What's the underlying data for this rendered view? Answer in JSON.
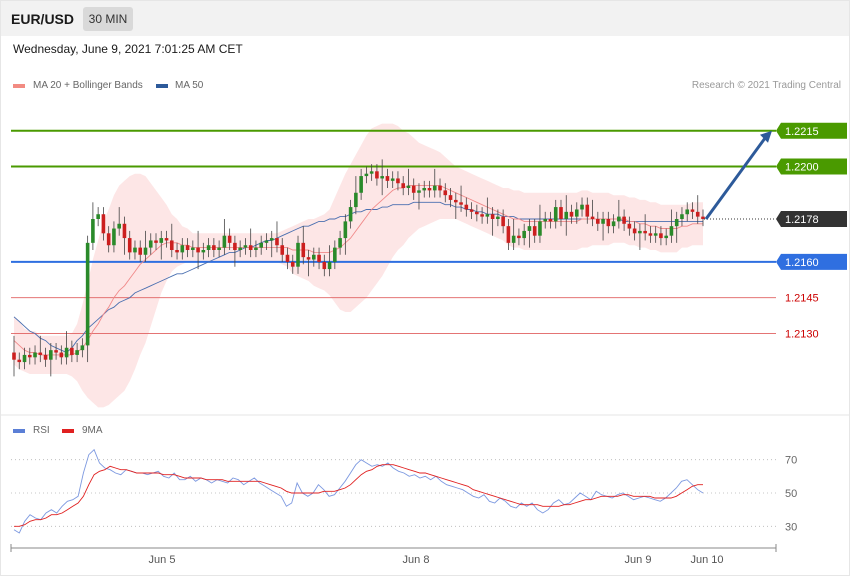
{
  "header": {
    "symbol": "EUR/USD",
    "timeframe": "30 MIN"
  },
  "timestamp": "Wednesday, June 9, 2021 7:01:25 AM CET",
  "legend": {
    "ma20": {
      "label": "MA 20 + Bollinger Bands",
      "color": "#f28b82"
    },
    "ma50": {
      "label": "MA 50",
      "color": "#2d5a9a"
    },
    "rsi": {
      "label": "RSI",
      "color": "#5b7fd6"
    },
    "rsi_ma": {
      "label": "9MA",
      "color": "#e02020"
    }
  },
  "credit": "Research © 2021 Trading Central",
  "chart_data": [
    {
      "type": "candlestick",
      "ylim": [
        1.21,
        1.223
      ],
      "xticks": [
        "Jun 5",
        "Jun 8",
        "Jun 9",
        "Jun 10"
      ],
      "current_price": {
        "label": "1.2178",
        "value": 1.2178
      },
      "levels": [
        {
          "label": "1.2215",
          "value": 1.2215,
          "kind": "resistance",
          "color": "#4a9a00"
        },
        {
          "label": "1.2200",
          "value": 1.22,
          "kind": "resistance",
          "color": "#4a9a00"
        },
        {
          "label": "1.2160",
          "value": 1.216,
          "kind": "pivot",
          "color": "#2f6fe0"
        },
        {
          "label": "1.2145",
          "value": 1.2145,
          "kind": "support",
          "color": "#e06060"
        },
        {
          "label": "1.2130",
          "value": 1.213,
          "kind": "support",
          "color": "#e06060"
        }
      ],
      "projection": {
        "from": 1.2178,
        "to": 1.2215
      },
      "close": [
        1.2119,
        1.2118,
        1.2121,
        1.212,
        1.2122,
        1.2121,
        1.2119,
        1.2123,
        1.2122,
        1.212,
        1.2124,
        1.2121,
        1.2123,
        1.2125,
        1.2168,
        1.2178,
        1.218,
        1.2172,
        1.2167,
        1.2174,
        1.2176,
        1.217,
        1.2164,
        1.2166,
        1.2163,
        1.2166,
        1.2169,
        1.2168,
        1.217,
        1.2169,
        1.2165,
        1.2164,
        1.2167,
        1.2165,
        1.2166,
        1.2164,
        1.2165,
        1.2167,
        1.2165,
        1.2166,
        1.2171,
        1.2168,
        1.2165,
        1.2166,
        1.2167,
        1.2165,
        1.2166,
        1.2168,
        1.2169,
        1.217,
        1.2167,
        1.2163,
        1.216,
        1.2158,
        1.2168,
        1.2162,
        1.2161,
        1.2163,
        1.216,
        1.2157,
        1.216,
        1.2166,
        1.217,
        1.2177,
        1.2183,
        1.2189,
        1.2196,
        1.2197,
        1.2198,
        1.2195,
        1.2196,
        1.2194,
        1.2195,
        1.2193,
        1.2191,
        1.2192,
        1.2189,
        1.219,
        1.2191,
        1.219,
        1.2192,
        1.219,
        1.2188,
        1.2186,
        1.2185,
        1.2184,
        1.2182,
        1.2181,
        1.218,
        1.2179,
        1.218,
        1.2178,
        1.2179,
        1.2175,
        1.2168,
        1.2171,
        1.217,
        1.2173,
        1.2175,
        1.2171,
        1.2177,
        1.2178,
        1.2177,
        1.2183,
        1.2178,
        1.2181,
        1.2179,
        1.2182,
        1.2184,
        1.2179,
        1.2178,
        1.2176,
        1.2178,
        1.2175,
        1.2177,
        1.2179,
        1.2176,
        1.2174,
        1.2172,
        1.2173,
        1.2172,
        1.2171,
        1.2172,
        1.217,
        1.2171,
        1.2175,
        1.2178,
        1.218,
        1.2182,
        1.2181,
        1.2179,
        1.2178
      ],
      "ma50": [
        1.2137,
        1.2135,
        1.2133,
        1.2131,
        1.213,
        1.2128,
        1.2127,
        1.2125,
        1.2124,
        1.2123,
        1.2122,
        1.2124,
        1.2127,
        1.2129,
        1.2132,
        1.2134,
        1.2136,
        1.2138,
        1.214,
        1.2141,
        1.2143,
        1.2144,
        1.2145,
        1.2147,
        1.2148,
        1.2149,
        1.215,
        1.2151,
        1.2152,
        1.2153,
        1.2154,
        1.2155,
        1.2155,
        1.2156,
        1.2157,
        1.2158,
        1.2159,
        1.216,
        1.2161,
        1.2162,
        1.2163,
        1.2164,
        1.2164,
        1.2165,
        1.2166,
        1.2166,
        1.2167,
        1.2168,
        1.2169,
        1.2169,
        1.217,
        1.2171,
        1.2172,
        1.2173,
        1.2174,
        1.2175,
        1.2175,
        1.2176,
        1.2177,
        1.2177,
        1.2178,
        1.2178,
        1.2179,
        1.2179,
        1.218,
        1.2181,
        1.2181,
        1.2182,
        1.2182,
        1.2182,
        1.2183,
        1.2183,
        1.2184,
        1.2184,
        1.2184,
        1.2184,
        1.2185,
        1.2185,
        1.2185,
        1.2185,
        1.2185,
        1.2185,
        1.2184,
        1.2184,
        1.2183,
        1.2183,
        1.2182,
        1.2182,
        1.2181,
        1.2181,
        1.218,
        1.218,
        1.218,
        1.2179,
        1.2179,
        1.2179,
        1.2178,
        1.2178,
        1.2178,
        1.2178,
        1.2178,
        1.2178,
        1.2178,
        1.2178,
        1.2178,
        1.2178,
        1.2178,
        1.2178,
        1.2178,
        1.2178,
        1.2178,
        1.2178,
        1.2178,
        1.2178,
        1.2178,
        1.2178,
        1.2177,
        1.2177,
        1.2177,
        1.2177,
        1.2177,
        1.2177,
        1.2177,
        1.2177,
        1.2177,
        1.2177,
        1.2177,
        1.2177,
        1.2177,
        1.2177,
        1.2177,
        1.2177
      ],
      "ma20": [
        1.2127,
        1.2125,
        1.2123,
        1.2122,
        1.2122,
        1.2121,
        1.2121,
        1.2121,
        1.2121,
        1.2121,
        1.2121,
        1.2121,
        1.2122,
        1.2124,
        1.2127,
        1.2131,
        1.2134,
        1.2138,
        1.2141,
        1.2145,
        1.2148,
        1.215,
        1.2153,
        1.2156,
        1.2159,
        1.2161,
        1.2163,
        1.2165,
        1.2167,
        1.2168,
        1.2168,
        1.2168,
        1.2167,
        1.2167,
        1.2166,
        1.2166,
        1.2166,
        1.2166,
        1.2166,
        1.2166,
        1.2166,
        1.2166,
        1.2166,
        1.2166,
        1.2166,
        1.2166,
        1.2166,
        1.2166,
        1.2166,
        1.2166,
        1.2166,
        1.2166,
        1.2166,
        1.2165,
        1.2165,
        1.2165,
        1.2165,
        1.2164,
        1.2164,
        1.2164,
        1.2164,
        1.2165,
        1.2166,
        1.2168,
        1.217,
        1.2173,
        1.2176,
        1.2179,
        1.2182,
        1.2184,
        1.2186,
        1.2188,
        1.219,
        1.2191,
        1.2191,
        1.2192,
        1.2192,
        1.2192,
        1.2192,
        1.2192,
        1.2192,
        1.2192,
        1.2191,
        1.219,
        1.2189,
        1.2188,
        1.2187,
        1.2186,
        1.2185,
        1.2184,
        1.2183,
        1.2182,
        1.2181,
        1.218,
        1.2179,
        1.2178,
        1.2178,
        1.2177,
        1.2177,
        1.2177,
        1.2177,
        1.2177,
        1.2177,
        1.2177,
        1.2177,
        1.2177,
        1.2177,
        1.2177,
        1.2178,
        1.2178,
        1.2178,
        1.2178,
        1.2178,
        1.2178,
        1.2178,
        1.2178,
        1.2178,
        1.2177,
        1.2177,
        1.2176,
        1.2176,
        1.2175,
        1.2175,
        1.2174,
        1.2174,
        1.2174,
        1.2174,
        1.2175,
        1.2175,
        1.2176,
        1.2176,
        1.2176
      ],
      "bb_width": [
        0.001,
        0.001,
        0.0009,
        0.0009,
        0.0009,
        0.0008,
        0.0008,
        0.0008,
        0.0008,
        0.0008,
        0.0008,
        0.0009,
        0.0012,
        0.0018,
        0.0024,
        0.003,
        0.0035,
        0.0039,
        0.0041,
        0.0043,
        0.0044,
        0.0044,
        0.0043,
        0.0041,
        0.0038,
        0.0035,
        0.003,
        0.0025,
        0.002,
        0.0016,
        0.0012,
        0.001,
        0.0008,
        0.0007,
        0.0006,
        0.0006,
        0.0006,
        0.0006,
        0.0006,
        0.0006,
        0.0006,
        0.0006,
        0.0006,
        0.0006,
        0.0006,
        0.0006,
        0.0006,
        0.0006,
        0.0006,
        0.0006,
        0.0006,
        0.0007,
        0.0008,
        0.001,
        0.0011,
        0.0012,
        0.0013,
        0.0014,
        0.0015,
        0.0016,
        0.0018,
        0.0022,
        0.0026,
        0.0029,
        0.0031,
        0.0032,
        0.0033,
        0.0034,
        0.0034,
        0.0033,
        0.0032,
        0.003,
        0.0028,
        0.0026,
        0.0024,
        0.0022,
        0.002,
        0.0018,
        0.0017,
        0.0016,
        0.0015,
        0.0014,
        0.0013,
        0.0012,
        0.0011,
        0.0011,
        0.0011,
        0.0011,
        0.0011,
        0.0011,
        0.0011,
        0.0011,
        0.0011,
        0.0011,
        0.0012,
        0.0012,
        0.0012,
        0.0012,
        0.0012,
        0.0012,
        0.0012,
        0.0012,
        0.0012,
        0.0012,
        0.0012,
        0.0012,
        0.0012,
        0.0012,
        0.0012,
        0.0012,
        0.0011,
        0.0011,
        0.0011,
        0.0011,
        0.001,
        0.001,
        0.001,
        0.001,
        0.001,
        0.001,
        0.001,
        0.001,
        0.001,
        0.001,
        0.001,
        0.001,
        0.001,
        0.0009,
        0.0009,
        0.0009,
        0.0009,
        0.0009
      ]
    },
    {
      "type": "line",
      "ylim": [
        20,
        80
      ],
      "yticks": [
        30,
        50,
        70
      ],
      "rsi": [
        28,
        26,
        33,
        37,
        35,
        34,
        38,
        40,
        38,
        42,
        45,
        46,
        48,
        62,
        73,
        76,
        68,
        65,
        64,
        62,
        61,
        64,
        63,
        62,
        62,
        61,
        62,
        63,
        60,
        59,
        62,
        58,
        58,
        60,
        57,
        59,
        58,
        56,
        58,
        57,
        56,
        59,
        58,
        55,
        57,
        59,
        56,
        54,
        52,
        50,
        48,
        42,
        44,
        56,
        50,
        48,
        50,
        55,
        52,
        48,
        49,
        53,
        57,
        62,
        67,
        70,
        68,
        66,
        67,
        66,
        68,
        65,
        63,
        62,
        60,
        61,
        59,
        60,
        58,
        60,
        57,
        55,
        54,
        53,
        52,
        50,
        48,
        47,
        49,
        45,
        44,
        47,
        45,
        42,
        41,
        44,
        42,
        44,
        40,
        38,
        40,
        44,
        46,
        43,
        44,
        47,
        50,
        48,
        46,
        51,
        49,
        48,
        47,
        49,
        50,
        48,
        46,
        47,
        48,
        47,
        46,
        45,
        47,
        50,
        53,
        57,
        58,
        55,
        52,
        50
      ],
      "rsi_ma": [
        30,
        30,
        31,
        33,
        34,
        34,
        35,
        37,
        37,
        38,
        40,
        42,
        44,
        48,
        55,
        61,
        63,
        64,
        66,
        65,
        64,
        64,
        63,
        62,
        62,
        62,
        62,
        62,
        61,
        61,
        61,
        60,
        59,
        59,
        59,
        59,
        58,
        58,
        58,
        58,
        57,
        57,
        57,
        57,
        57,
        57,
        57,
        56,
        55,
        54,
        53,
        51,
        50,
        50,
        50,
        50,
        50,
        50,
        51,
        51,
        51,
        52,
        53,
        55,
        58,
        61,
        63,
        64,
        66,
        67,
        67,
        67,
        66,
        65,
        64,
        63,
        62,
        62,
        61,
        60,
        59,
        58,
        57,
        56,
        55,
        54,
        52,
        51,
        50,
        49,
        48,
        47,
        46,
        45,
        44,
        43,
        43,
        43,
        43,
        42,
        42,
        42,
        42,
        43,
        43,
        44,
        45,
        46,
        46,
        47,
        48,
        48,
        48,
        48,
        49,
        49,
        48,
        48,
        48,
        48,
        47,
        47,
        47,
        47,
        48,
        50,
        52,
        54,
        55,
        55
      ]
    }
  ]
}
